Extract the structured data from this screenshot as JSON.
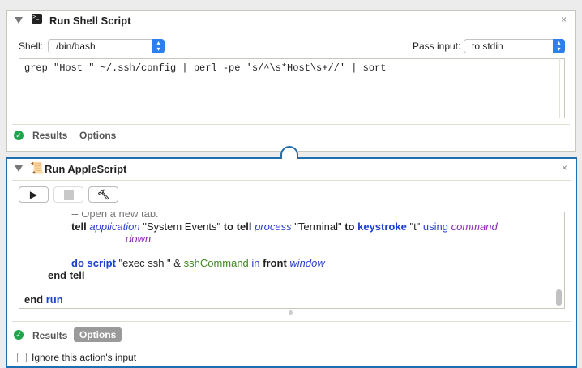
{
  "shell_action": {
    "title": "Run Shell Script",
    "shell_label": "Shell:",
    "shell_value": "/bin/bash",
    "pass_input_label": "Pass input:",
    "pass_input_value": "to stdin",
    "script": "grep \"Host \" ~/.ssh/config | perl -pe 's/^\\s*Host\\s+//' | sort",
    "results": "Results",
    "options": "Options"
  },
  "applescript_action": {
    "title": "Run AppleScript",
    "results": "Results",
    "options": "Options",
    "ignore_input": "Ignore this action's input",
    "lines": {
      "comment": "-- Open a new tab.",
      "l1": {
        "a": "tell",
        "b": "application",
        "c": "\"System Events\"",
        "d": "to tell",
        "e": "process",
        "f": "\"Terminal\"",
        "g": "to",
        "h": "keystroke",
        "i": "\"t\"",
        "j": "using",
        "k": "command",
        "l": "down"
      },
      "l2": {
        "a": "do script",
        "b": "\"exec ssh \" &",
        "c": "sshCommand",
        "d": "in",
        "e": "front",
        "f": "window"
      },
      "l3": "end tell",
      "l4a": "end",
      "l4b": "run"
    }
  },
  "close": "×"
}
